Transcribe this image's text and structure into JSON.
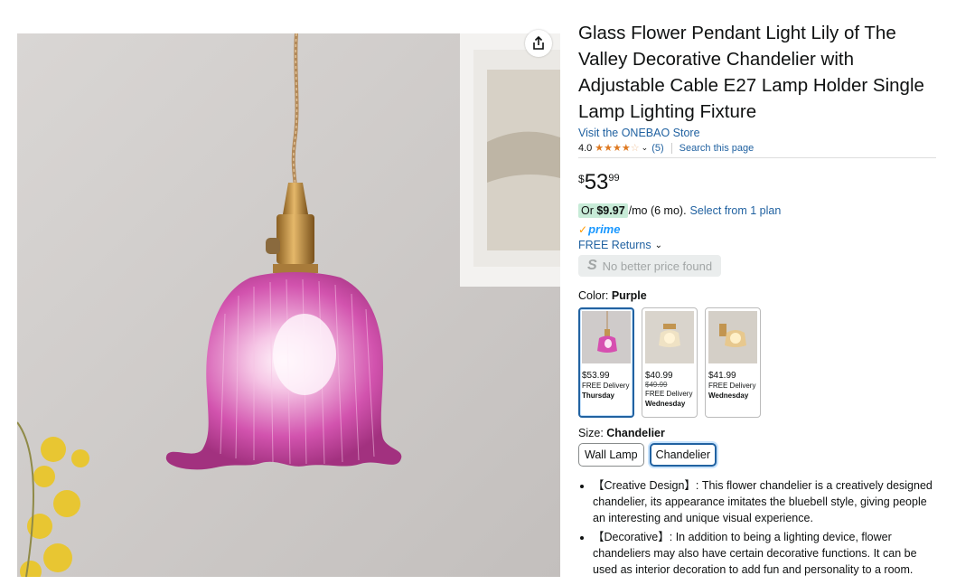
{
  "product": {
    "title": "Glass Flower Pendant Light Lily of The Valley Decorative Chandelier with Adjustable Cable E27 Lamp Holder Single Lamp Lighting Fixture",
    "store_link": "Visit the ONEBAO Store",
    "rating_value": "4.0",
    "rating_stars": 4,
    "rating_count": "(5)",
    "search_page": "Search this page",
    "price_symbol": "$",
    "price_whole": "53",
    "price_fraction": "99",
    "monthly_or": "Or ",
    "monthly_amount": "$9.97",
    "monthly_rest": "/mo (6 mo).",
    "monthly_plan_link": "Select from 1 plan",
    "prime_label": "prime",
    "returns_label": "FREE Returns",
    "no_better_price": "No better price found"
  },
  "color": {
    "label": "Color: ",
    "selected": "Purple",
    "options": [
      {
        "price": "$53.99",
        "old_price": "",
        "delivery": "FREE Delivery",
        "day": "Thursday"
      },
      {
        "price": "$40.99",
        "old_price": "$49.99",
        "delivery": "FREE Delivery",
        "day": "Wednesday"
      },
      {
        "price": "$41.99",
        "old_price": "",
        "delivery": "FREE Delivery",
        "day": "Wednesday"
      }
    ]
  },
  "size": {
    "label": "Size: ",
    "selected": "Chandelier",
    "options": [
      "Wall Lamp",
      "Chandelier"
    ]
  },
  "bullets": [
    "【Creative Design】: This flower chandelier is a creatively designed chandelier, its appearance imitates the bluebell style, giving people an interesting and unique visual experience.",
    "【Decorative】: In addition to being a lighting device, flower chandeliers may also have certain decorative functions. It can be used as interior decoration to add fun and personality to a room."
  ],
  "colors": {
    "link": "#2162a1",
    "star": "#de7921",
    "prime_blue": "#1a98ff",
    "deal_green": "#c7ebd7",
    "shade_pink": "#d64fb0"
  },
  "icons": [
    "share-icon",
    "star-icon",
    "chevron-down-icon",
    "prime-check-icon"
  ]
}
